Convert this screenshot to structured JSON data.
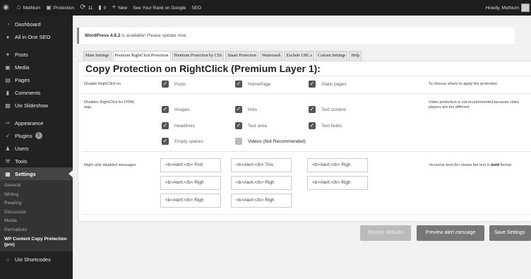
{
  "adminbar": {
    "site_name": "MetNum",
    "plugin_link": "Protection",
    "updates_count": "11",
    "comments_count": "0",
    "new_label": "New",
    "seo_rank": "See Your Rank on Google",
    "seo_label": "SEO",
    "howdy": "Howdy, MetNum"
  },
  "sidebar": {
    "items": [
      {
        "label": "Dashboard",
        "icon": "dashboard-icon"
      },
      {
        "label": "All in One SEO",
        "icon": "seo-icon"
      },
      {
        "label": "Posts",
        "icon": "pin-icon"
      },
      {
        "label": "Media",
        "icon": "media-icon"
      },
      {
        "label": "Pages",
        "icon": "pages-icon"
      },
      {
        "label": "Comments",
        "icon": "comments-icon"
      },
      {
        "label": "Uix Slideshow",
        "icon": "slideshow-icon"
      },
      {
        "label": "Appearance",
        "icon": "brush-icon"
      },
      {
        "label": "Plugins",
        "icon": "plugin-icon",
        "badge": "5"
      },
      {
        "label": "Users",
        "icon": "users-icon"
      },
      {
        "label": "Tools",
        "icon": "tools-icon"
      },
      {
        "label": "Settings",
        "icon": "settings-icon"
      },
      {
        "label": "Uix Shortcodes",
        "icon": "shortcodes-icon"
      }
    ],
    "submenu": [
      "General",
      "Writing",
      "Reading",
      "Discussion",
      "Media",
      "Permalinks",
      "WP Content Copy Protection (pro)"
    ]
  },
  "notice": {
    "bold": "WordPress 4.8.2",
    "text": " is available! Please update now."
  },
  "tabs": [
    "Main Settings",
    "Premium RightClick Protection",
    "Premium Protection by CSS",
    "Smart Protection",
    "Watermark",
    "Exclude URL's",
    "Custom Settings",
    "Help"
  ],
  "panel": {
    "title": "Copy Protection on RightClick (Premium Layer 1):",
    "row1": {
      "label": "Disable RightClick on",
      "options": [
        {
          "label": "Posts",
          "checked": true
        },
        {
          "label": "HomePage",
          "checked": true
        },
        {
          "label": "Static pages",
          "checked": true
        }
      ],
      "desc": "To choose where to apply the protection"
    },
    "row2": {
      "label": "Disables RightClick for HTML tags",
      "options": [
        {
          "label": "Images",
          "checked": true
        },
        {
          "label": "links",
          "checked": true
        },
        {
          "label": "Text content",
          "checked": true
        },
        {
          "label": "Headlines",
          "checked": true
        },
        {
          "label": "Text area",
          "checked": true
        },
        {
          "label": "Text fields",
          "checked": true
        },
        {
          "label": "Empty spaces",
          "checked": true
        },
        {
          "label": "Videos (Not Recommended)",
          "checked": false
        }
      ],
      "desc": "Video protection is not recommended because video players are too different"
    },
    "row3": {
      "label": "Right click disabled messages",
      "fields": [
        "<b>Alert:</b> Prot",
        "<b>Alert:</b> This",
        "<b>Alert:</b> Righ",
        "<b>Alert:</b> Righ",
        "<b>Alert:</b> Righ",
        "<b>Alert:</b> Righ"
      ],
      "desc_pre": "<b>some text</b> shows the text in ",
      "desc_bold": "bold",
      "desc_post": " format"
    }
  },
  "buttons": {
    "restore": "Restore defaults",
    "preview": "Preview alert message",
    "save": "Save Settings"
  },
  "colors": {
    "adminbar_bg": "#1e1e1e",
    "sidebar_bg": "#222222",
    "content_bg": "#f1f1f1",
    "checkbox": "#555555",
    "button": "#777777"
  }
}
